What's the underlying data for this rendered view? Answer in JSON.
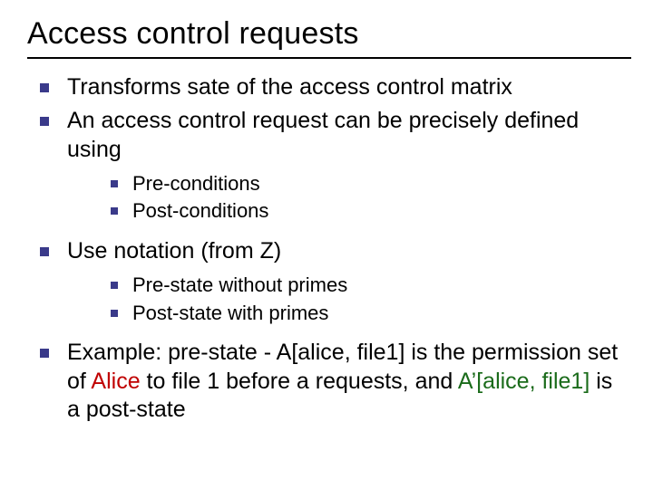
{
  "title": "Access control requests",
  "bullets": {
    "b1": "Transforms sate of the access control matrix",
    "b2": "An access control request can be precisely defined using",
    "b2a": "Pre-conditions",
    "b2b": "Post-conditions",
    "b3": "Use notation (from Z)",
    "b3a": "Pre-state without primes",
    "b3b": "Post-state with primes",
    "b4_pre": "Example: pre-state - A[alice, file1] is the permission set of ",
    "b4_alice": "Alice",
    "b4_mid": " to file 1 before a requests, and ",
    "b4_aprime": "A’[alice, file1]",
    "b4_post": " is a post-state"
  }
}
